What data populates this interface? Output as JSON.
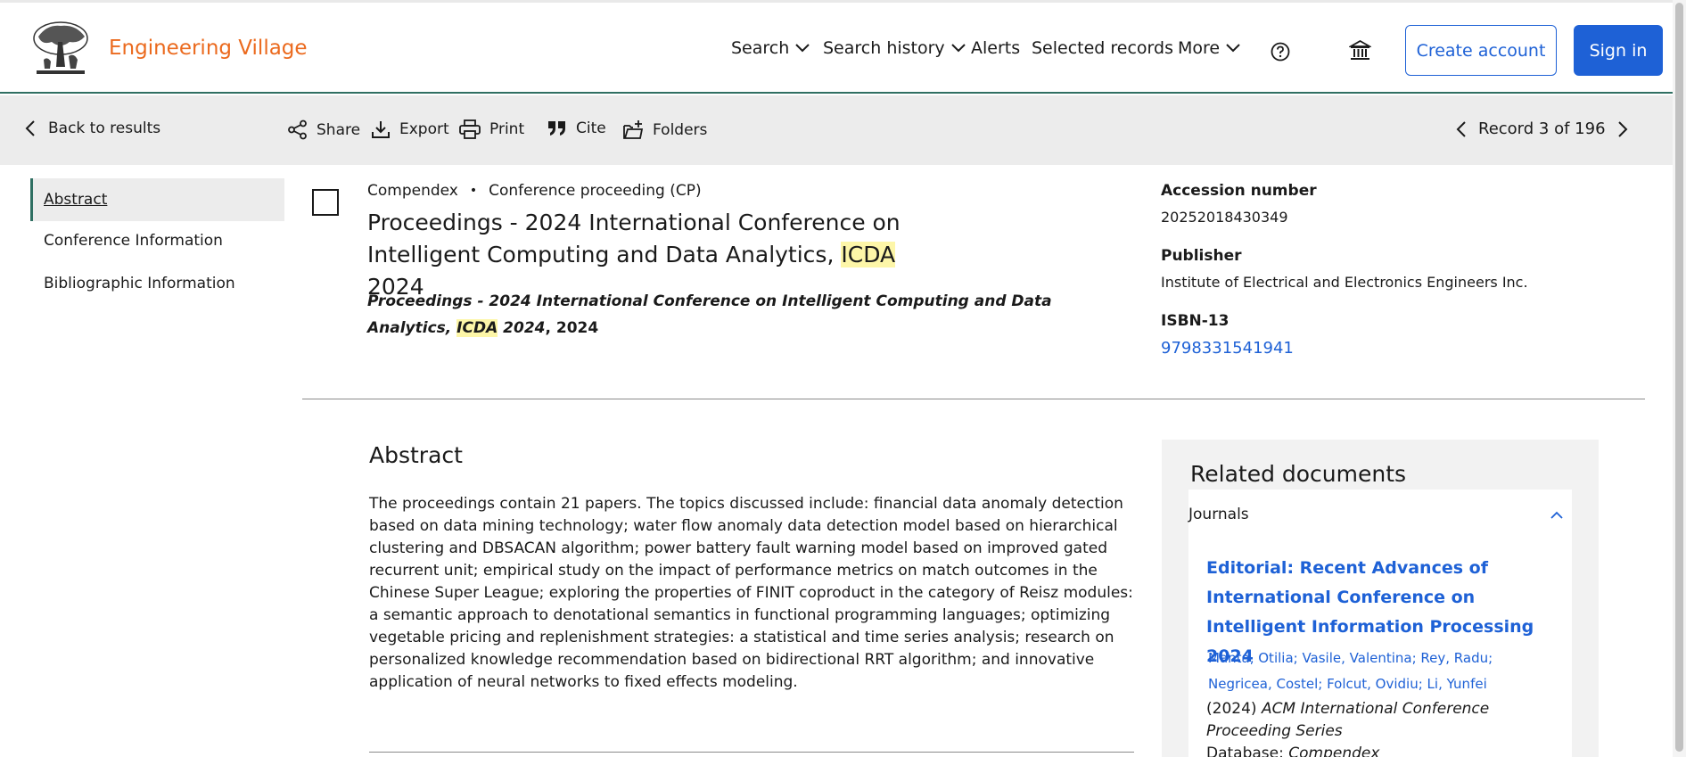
{
  "header": {
    "brand": "Engineering Village",
    "nav": [
      {
        "label": "Search",
        "dropdown": true
      },
      {
        "label": "Search history",
        "dropdown": true
      },
      {
        "label": "Alerts",
        "dropdown": false
      },
      {
        "label": "Selected records",
        "dropdown": false
      },
      {
        "label": "More",
        "dropdown": true
      }
    ],
    "create_account": "Create account",
    "sign_in": "Sign in",
    "colors": {
      "brand": "#eb6a1e",
      "accent": "#1e61d6",
      "rule": "#2f6f62"
    }
  },
  "toolbar": {
    "back": "Back to results",
    "share": "Share",
    "export": "Export",
    "print": "Print",
    "cite": "Cite",
    "folders": "Folders",
    "record_position": "Record 3 of 196"
  },
  "sidebar": {
    "items": [
      {
        "label": "Abstract",
        "active": true
      },
      {
        "label": "Conference Information",
        "active": false
      },
      {
        "label": "Bibliographic Information",
        "active": false
      }
    ]
  },
  "record": {
    "database": "Compendex",
    "doc_type": "Conference proceeding (CP)",
    "title_part1": "Proceedings - 2024 International Conference on Intelligent Computing and Data Analytics,",
    "title_highlight": "ICDA",
    "title_part2": "2024",
    "source_italic1": "Proceedings - 2024 International Conference on Intelligent Computing and Data Analytics,",
    "source_highlight": "ICDA",
    "source_italic2": "2024",
    "source_year": ", 2024"
  },
  "details": {
    "accession_label": "Accession number",
    "accession_value": "20252018430349",
    "publisher_label": "Publisher",
    "publisher_value": "Institute of Electrical and Electronics Engineers Inc.",
    "isbn_label": "ISBN-13",
    "isbn_value": "9798331541941"
  },
  "abstract": {
    "heading": "Abstract",
    "text": "The proceedings contain 21 papers. The topics discussed include: financial data anomaly detection based on data mining technology; water flow anomaly data detection model based on hierarchical clustering and DBSACAN algorithm; power battery fault warning model based on improved gated recurrent unit; empirical study on the impact of performance metrics on match outcomes in the Chinese Super League; exploring the properties of FINIT coproduct in the category of Reisz modules: a semantic approach to denotational semantics in functional programming languages; optimizing vegetable pricing and replenishment strategies: a statistical and time series analysis; research on personalized knowledge recommendation based on bidirectional RRT algorithm; and innovative application of neural networks to fixed effects modeling."
  },
  "related": {
    "heading": "Related documents",
    "tab": "Journals",
    "article_title": "Editorial: Recent Advances of International Conference on Intelligent Information Processing 2024",
    "authors_line1": "Manta, Otilia; Vasile, Valentina; Rey, Radu;",
    "authors_line2": "Negricea, Costel; Folcut, Ovidiu;  Li, Yunfei",
    "cite_year": "(2024)",
    "cite_series": "ACM International Conference Proceeding Series",
    "database_label": "Database:",
    "database_value": "Compendex"
  }
}
